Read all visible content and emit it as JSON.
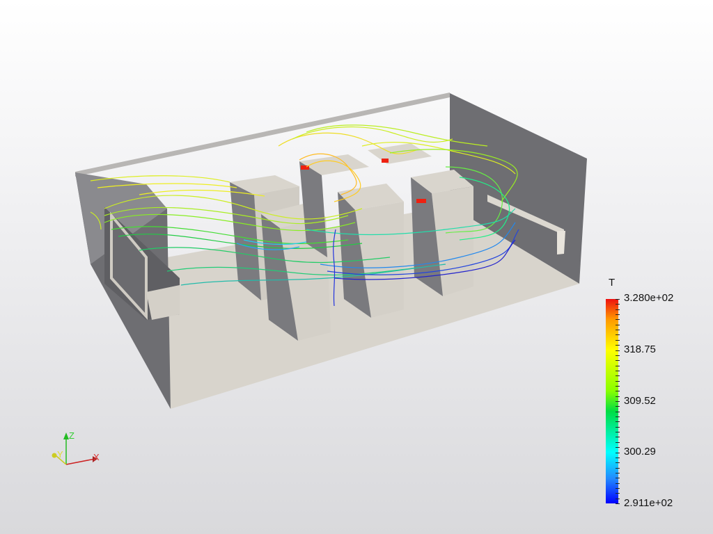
{
  "legend": {
    "title": "T",
    "labels": [
      "3.280e+02",
      "318.75",
      "309.52",
      "300.29",
      "2.911e+02"
    ],
    "colors": [
      "#ee1010",
      "#ffff00",
      "#00dd44",
      "#00ffff",
      "#0000ff"
    ]
  },
  "axes": {
    "z": "Z",
    "y": "Y",
    "x": "X"
  },
  "colors": {
    "wall_dark": "#6e6e72",
    "floor": "#d8d4cc",
    "cabinet_light": "#d9d5cd",
    "cabinet_dark": "#808084"
  }
}
